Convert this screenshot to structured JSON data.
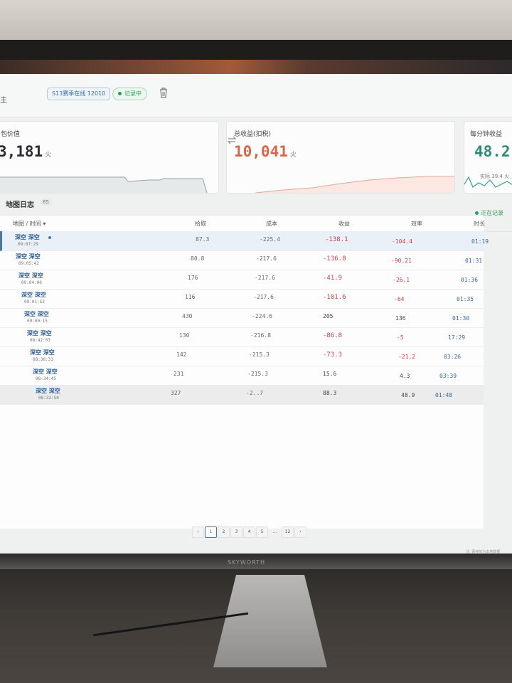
{
  "topbar": {
    "left_text": "主",
    "season_chip": "S13赛季在线 12010",
    "recording_chip": "记录中",
    "delete_icon": "trash-icon"
  },
  "cards": {
    "bag_value": {
      "title": "包价值",
      "value": "3,181",
      "unit": "火"
    },
    "total_income": {
      "title": "总收益(扣税)",
      "value": "10,041",
      "unit": "火",
      "swap_icon": "swap-arrows-icon"
    },
    "per_minute": {
      "title": "每分钟收益",
      "value": "48.2",
      "actual_label": "实际",
      "actual_value": "39.4",
      "unit": "火"
    }
  },
  "log": {
    "title": "地图日志",
    "count": "85",
    "recording_status": "正在记录",
    "columns": {
      "map_time": "地图 / 时间",
      "pickup": "拾取",
      "cost": "成本",
      "income": "收益",
      "efficiency": "效率",
      "duration": "时长"
    },
    "rows": [
      {
        "map": "深空 深空",
        "time": "09:07:29",
        "pickup": "87.3",
        "cost": "-225.4",
        "income": "-138.1",
        "efficiency": "-104.4",
        "duration": "01:19"
      },
      {
        "map": "深空 深空",
        "time": "09:05:42",
        "pickup": "80.8",
        "cost": "-217.6",
        "income": "-136.8",
        "efficiency": "-90.21",
        "duration": "01:31"
      },
      {
        "map": "深空 深空",
        "time": "09:04:00",
        "pickup": "176",
        "cost": "-217.6",
        "income": "-41.9",
        "efficiency": "-26.1",
        "duration": "01:36"
      },
      {
        "map": "深空 深空",
        "time": "09:01:52",
        "pickup": "116",
        "cost": "-217.6",
        "income": "-101.6",
        "efficiency": "-64",
        "duration": "01:35"
      },
      {
        "map": "深空 深空",
        "time": "09:00:15",
        "pickup": "430",
        "cost": "-224.6",
        "income": "205",
        "efficiency": "136",
        "duration": "01:30"
      },
      {
        "map": "深空 深空",
        "time": "08:42:03",
        "pickup": "130",
        "cost": "-216.8",
        "income": "-86.8",
        "efficiency": "-5",
        "duration": "17:29"
      },
      {
        "map": "深空 深空",
        "time": "08:38:31",
        "pickup": "142",
        "cost": "-215.3",
        "income": "-73.3",
        "efficiency": "-21.2",
        "duration": "03:26"
      },
      {
        "map": "深空 深空",
        "time": "08:34:45",
        "pickup": "231",
        "cost": "-215.3",
        "income": "15.6",
        "efficiency": "4.3",
        "duration": "03:39"
      },
      {
        "map": "深空 深空",
        "time": "08:32:50",
        "pickup": "327",
        "cost": "-2..7",
        "income": "88.3",
        "efficiency": "48.9",
        "duration": "01:48"
      }
    ]
  },
  "pager": {
    "prev": "‹",
    "pages": [
      "1",
      "2",
      "3",
      "4",
      "5",
      "…",
      "12"
    ],
    "next": "›",
    "current": "1"
  },
  "footnote": "注: 保存的为本地数据",
  "monitor_brand": "SKYWORTH",
  "colors": {
    "accent": "#4a76a8",
    "negative": "#c44545",
    "positive": "#2e9a57",
    "income_value": "#d8664a"
  }
}
